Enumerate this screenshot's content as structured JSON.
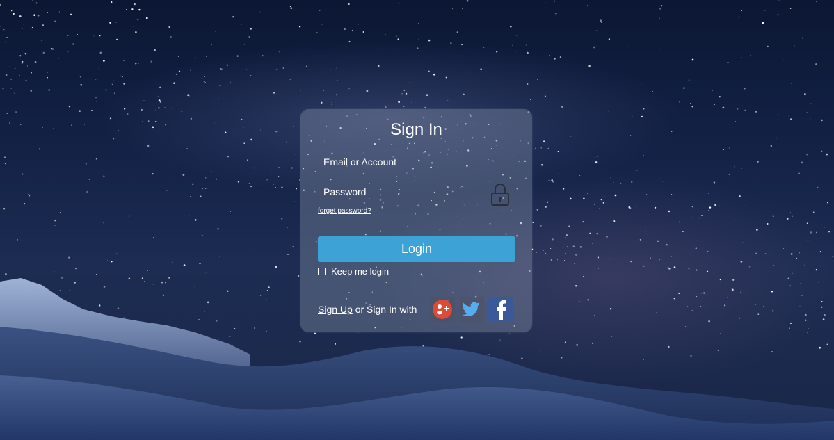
{
  "signin": {
    "title": "Sign In",
    "email_placeholder": "Email or Account",
    "password_placeholder": "Password",
    "forget_password": "forget password?",
    "login_button": "Login",
    "keep_login": "Keep me login",
    "signup_link": "Sign Up",
    "signin_with": " or Sign In with"
  },
  "social": [
    {
      "name": "google-plus-icon"
    },
    {
      "name": "twitter-icon"
    },
    {
      "name": "facebook-icon"
    }
  ],
  "colors": {
    "login_button": "#3da3d6",
    "facebook": "#3b5998",
    "google": "#dc4a38",
    "twitter": "#55acee"
  }
}
